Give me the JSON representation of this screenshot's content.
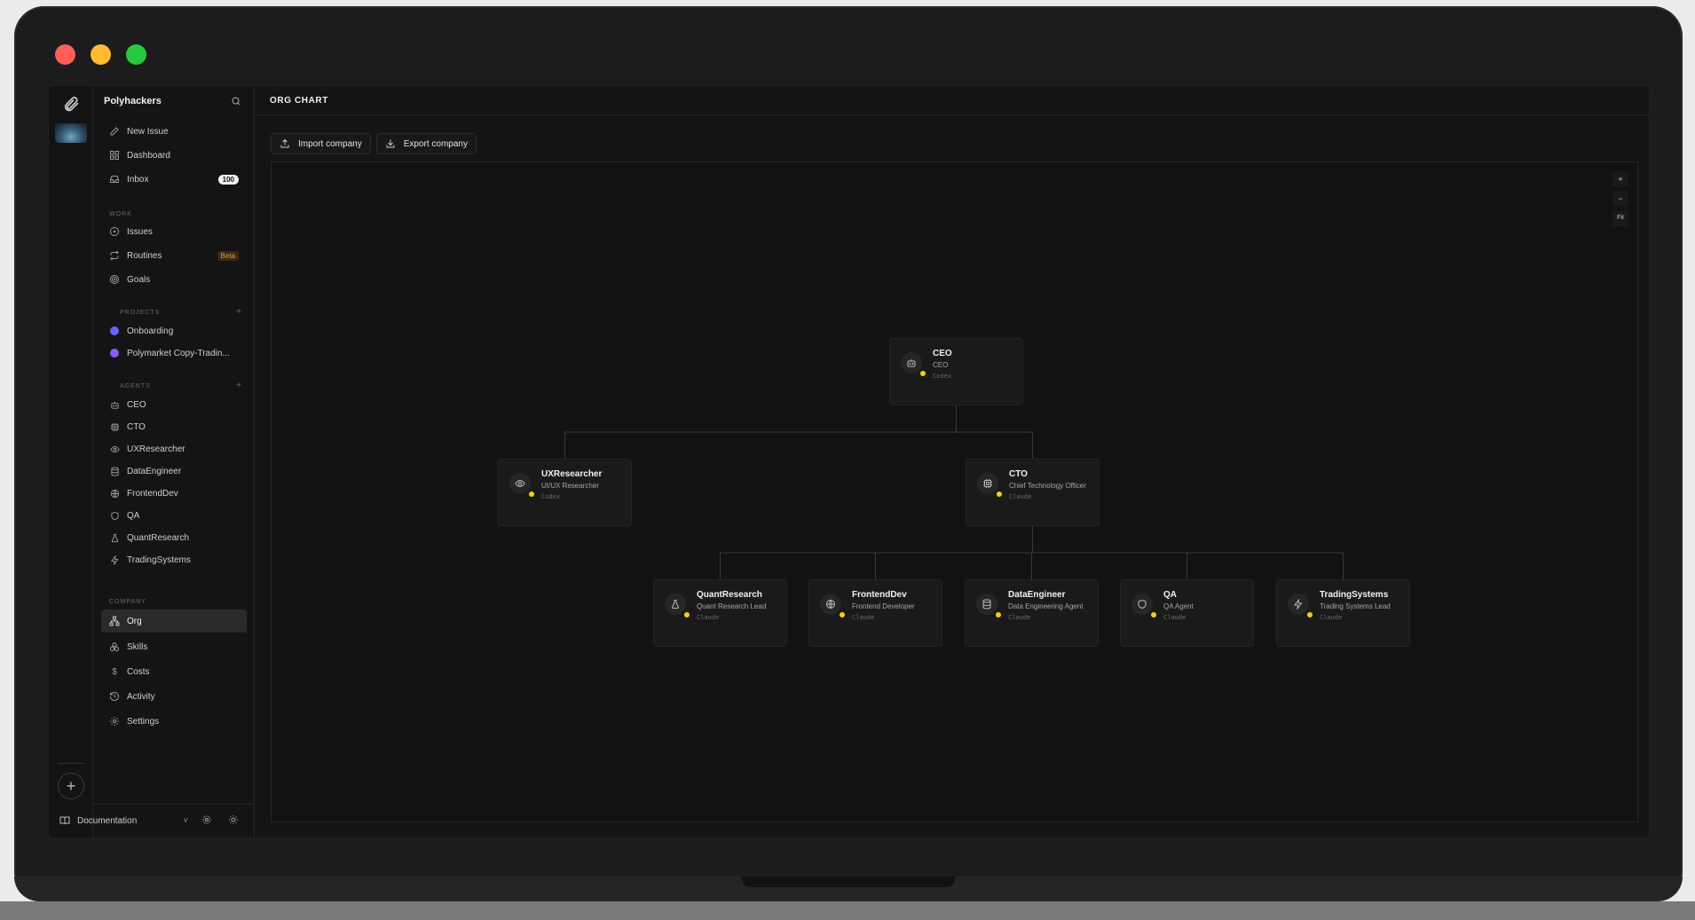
{
  "sidebar": {
    "company_name": "Polyhackers",
    "top_items": [
      {
        "label": "New Issue",
        "icon": "edit-icon"
      },
      {
        "label": "Dashboard",
        "icon": "dashboard-icon"
      },
      {
        "label": "Inbox",
        "icon": "inbox-icon",
        "count": "100"
      }
    ],
    "work_label": "WORK",
    "work_items": [
      {
        "label": "Issues",
        "icon": "circle-dot-icon"
      },
      {
        "label": "Routines",
        "icon": "repeat-icon",
        "badge": "Beta"
      },
      {
        "label": "Goals",
        "icon": "target-icon"
      }
    ],
    "projects_label": "PROJECTS",
    "projects": [
      {
        "label": "Onboarding",
        "color": "#6366f1"
      },
      {
        "label": "Polymarket Copy-Tradin...",
        "color": "#8b5cf6"
      }
    ],
    "agents_label": "AGENTS",
    "agents": [
      {
        "label": "CEO",
        "icon": "bot-icon"
      },
      {
        "label": "CTO",
        "icon": "cpu-icon"
      },
      {
        "label": "UXResearcher",
        "icon": "eye-icon"
      },
      {
        "label": "DataEngineer",
        "icon": "database-icon"
      },
      {
        "label": "FrontendDev",
        "icon": "globe-icon"
      },
      {
        "label": "QA",
        "icon": "shield-icon"
      },
      {
        "label": "QuantResearch",
        "icon": "flask-icon"
      },
      {
        "label": "TradingSystems",
        "icon": "zap-icon"
      }
    ],
    "company_label": "COMPANY",
    "company_items": [
      {
        "label": "Org",
        "icon": "org-icon",
        "active": true
      },
      {
        "label": "Skills",
        "icon": "boxes-icon"
      },
      {
        "label": "Costs",
        "icon": "dollar-icon"
      },
      {
        "label": "Activity",
        "icon": "history-icon"
      },
      {
        "label": "Settings",
        "icon": "gear-icon"
      }
    ],
    "footer": {
      "documentation": "Documentation",
      "chevron": "v"
    }
  },
  "main": {
    "title": "ORG CHART",
    "import_label": "Import company",
    "export_label": "Export company",
    "zoom": {
      "in": "+",
      "out": "−",
      "fit": "Fit"
    }
  },
  "org": {
    "nodes": [
      {
        "id": "ceo",
        "name": "CEO",
        "role": "CEO",
        "model": "Codex",
        "icon": "bot-icon",
        "status_color": "#facc15"
      },
      {
        "id": "ux",
        "name": "UXResearcher",
        "role": "UI/UX Researcher",
        "model": "Codex",
        "icon": "eye-icon",
        "status_color": "#facc15"
      },
      {
        "id": "cto",
        "name": "CTO",
        "role": "Chief Technology Officer",
        "model": "Claude",
        "icon": "cpu-icon",
        "status_color": "#facc15"
      },
      {
        "id": "quant",
        "name": "QuantResearch",
        "role": "Quant Research Lead",
        "model": "Claude",
        "icon": "flask-icon",
        "status_color": "#facc15"
      },
      {
        "id": "fe",
        "name": "FrontendDev",
        "role": "Frontend Developer",
        "model": "Claude",
        "icon": "globe-icon",
        "status_color": "#facc15"
      },
      {
        "id": "de",
        "name": "DataEngineer",
        "role": "Data Engineering Agent",
        "model": "Claude",
        "icon": "database-icon",
        "status_color": "#facc15"
      },
      {
        "id": "qa",
        "name": "QA",
        "role": "QA Agent",
        "model": "Claude",
        "icon": "shield-icon",
        "status_color": "#facc15"
      },
      {
        "id": "ts",
        "name": "TradingSystems",
        "role": "Trading Systems Lead",
        "model": "Claude",
        "icon": "zap-icon",
        "status_color": "#facc15"
      }
    ],
    "reports_to": {
      "ux": "ceo",
      "cto": "ceo",
      "quant": "cto",
      "fe": "cto",
      "de": "cto",
      "qa": "cto",
      "ts": "cto"
    }
  }
}
